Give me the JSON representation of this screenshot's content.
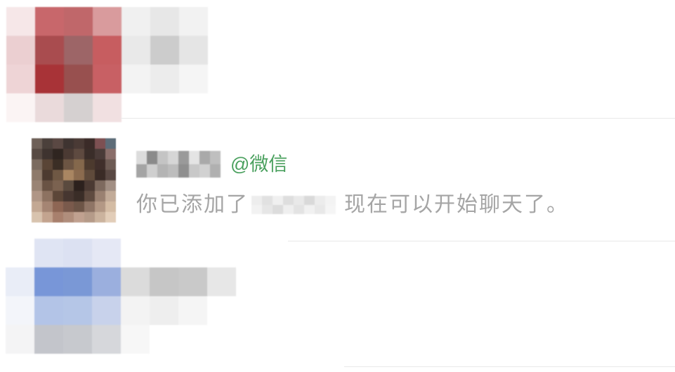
{
  "colors": {
    "background": "#ffffff",
    "accent_green": "#4aa05e",
    "message_text": "#a5a5a5",
    "divider": "#e9e9e9"
  },
  "chat_list": {
    "items": [
      {
        "mosaic": [
          [
            "#f6e7e8",
            "#c8676b",
            "#c0676a",
            "#d99b9d",
            "#f0f0f0",
            "#e7e7e7",
            "#f2f2f2"
          ],
          [
            "#ebcfd1",
            "#a94c4f",
            "#9d6567",
            "#c75d60",
            "#e9e9e9",
            "#cccccc",
            "#e5e5e5"
          ],
          [
            "#eed4d6",
            "#a83337",
            "#98504f",
            "#c86064",
            "#f3f3f3",
            "#ececec",
            "#f5f5f5"
          ],
          [
            "#fbf4f4",
            "#eadadb",
            "#d5d0d0",
            "#f1e0e1",
            null,
            null,
            null
          ]
        ]
      },
      {
        "avatar_mosaic": [
          [
            "#6e6058",
            "#4b403b",
            "#5a4843",
            "#3f3431",
            "#4a3a35",
            "#3b2b28",
            "#7d5052",
            "#5d6c78"
          ],
          [
            "#574a43",
            "#3e332f",
            "#2f2520",
            "#4b3a33",
            "#5e4a40",
            "#3a2d29",
            "#4a3b38",
            "#8a6e6a"
          ],
          [
            "#7b6b5f",
            "#5a4536",
            "#3b2e25",
            "#6c5543",
            "#84684c",
            "#4c3a2e",
            "#402f2b",
            "#6d5b54"
          ],
          [
            "#8e7a6a",
            "#4d3b30",
            "#6f5844",
            "#a98662",
            "#8b6b4f",
            "#5f4a3b",
            "#3a2b26",
            "#594843"
          ],
          [
            "#9a8474",
            "#6a5344",
            "#7b6250",
            "#5a4a3e",
            "#2c211d",
            "#4b3a33",
            "#7e6a5f",
            "#a28f84"
          ],
          [
            "#b09686",
            "#8d7261",
            "#5c4638",
            "#463630",
            "#3a2d27",
            "#5f4b40",
            "#9a8171",
            "#c2ab98"
          ],
          [
            "#c3a893",
            "#a58573",
            "#8e6654",
            "#7a5a4c",
            "#6d5547",
            "#8f7566",
            "#b39885",
            "#d4bca4"
          ],
          [
            "#d8c3ae",
            "#c3a48f",
            "#a8806d",
            "#b08e7c",
            "#c0a190",
            "#b59b89",
            "#cbb39e",
            "#e2cdb8"
          ]
        ],
        "name_mosaic": [
          [
            "#dcdcdc",
            "#8a8a8a",
            "#c4c4c4",
            "#d6d6d6",
            "#9a9a9a",
            "#e4e4e4",
            "#a9a9a9",
            "#bfbfbf"
          ],
          [
            "#a4a4a4",
            "#cfcfcf",
            "#b4b4b4",
            "#bdbdbd",
            "#8f8f8f",
            "#c8c8c8",
            "#d1d1d1",
            "#b0b0b0"
          ]
        ],
        "source_label": "@微信",
        "message": {
          "prefix": "你已添加了",
          "name_mosaic": [
            [
              "#ededed",
              "#e1e1e1",
              "#f0f0f0",
              "#dedede",
              "#e9e9e9",
              "#d9d9d9",
              "#ececec",
              "#f3f3f3"
            ],
            [
              "#f2f2f2",
              "#e6e6e6",
              "#dcdcdc",
              "#efefef",
              "#e3e3e3",
              "#f1f1f1",
              "#e8e8e8",
              "#f5f5f5"
            ]
          ],
          "suffix": "现在可以开始聊天了。"
        }
      },
      {
        "mosaic": [
          [
            null,
            "#dfe4f3",
            "#dce1f2",
            "#e5e8f5",
            null,
            null,
            null,
            null
          ],
          [
            "#e9edf7",
            "#7896d8",
            "#7a98d6",
            "#9bafde",
            "#dbdbdb",
            "#c6c6c6",
            "#c9c9c9",
            "#e7e7e7"
          ],
          [
            "#f3f5fa",
            "#b3c4e7",
            "#b5c6e7",
            "#c8d2eb",
            "#f3f3f3",
            "#eeeeee",
            "#f5f5f5",
            null
          ],
          [
            "#f4f4f5",
            "#c3c5cb",
            "#c7c9ce",
            "#d6d7db",
            "#f7f7f7",
            null,
            null,
            null
          ]
        ]
      }
    ]
  }
}
